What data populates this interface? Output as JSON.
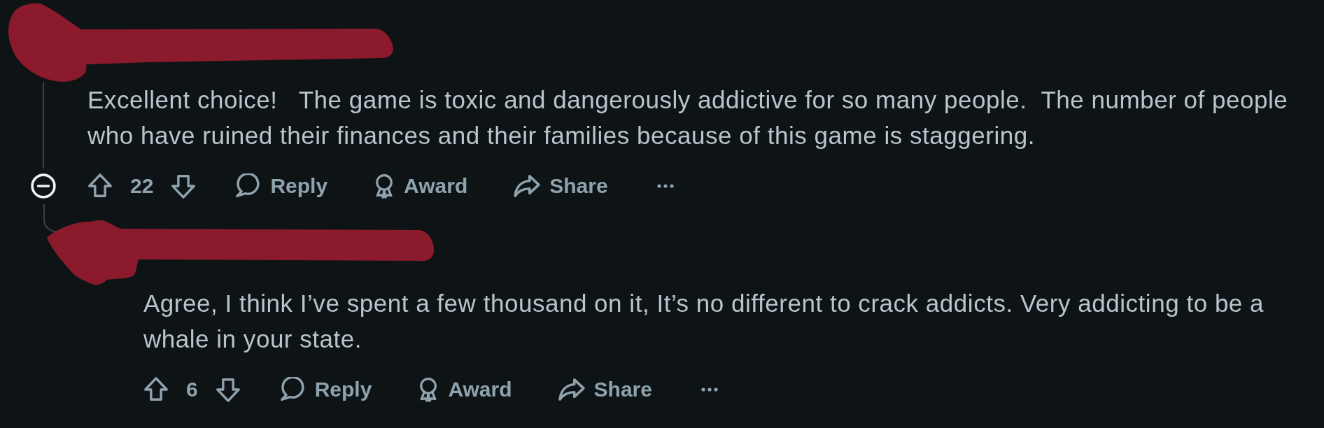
{
  "comments": [
    {
      "redacted": true,
      "body": "Excellent choice!   The game is toxic and dangerously addictive for so many people.  The number of people who have ruined their finances and their families because of this game is staggering.",
      "votes": "22",
      "expanded": true,
      "actions": [
        {
          "kind": "reply",
          "label": "Reply"
        },
        {
          "kind": "award",
          "label": "Award"
        },
        {
          "kind": "share",
          "label": "Share"
        },
        {
          "kind": "more"
        }
      ],
      "replies": [
        {
          "redacted": true,
          "body": "Agree, I think I’ve spent a few thousand on it, It’s no different to crack addicts. Very addicting to be a whale in your state.",
          "votes": "6",
          "actions": [
            {
              "kind": "reply",
              "label": "Reply"
            },
            {
              "kind": "award",
              "label": "Award"
            },
            {
              "kind": "share",
              "label": "Share"
            },
            {
              "kind": "more"
            }
          ]
        }
      ]
    }
  ]
}
